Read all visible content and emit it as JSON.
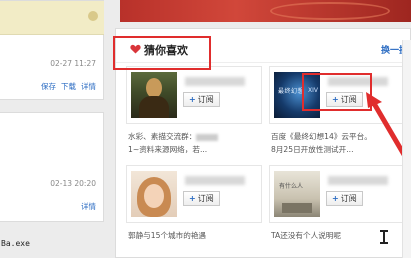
{
  "left": {
    "card1": {
      "time": "02-27 11:27",
      "actions": [
        "保存",
        "下载",
        "详情"
      ]
    },
    "card2": {
      "time": "02-13 20:20",
      "action": "详情"
    },
    "code_text": "Ba.exe"
  },
  "panel": {
    "title": "猜你喜欢",
    "refresh_label": "换一换",
    "items": [
      {
        "button_label": "订阅",
        "desc_line1": "水彩、素描交流群：",
        "desc_line2": "1~资料来源网络，若..."
      },
      {
        "button_label": "订阅",
        "thumb_text_1": "最终幻想",
        "thumb_text_2": "XIV",
        "desc_line1": "百度《最终幻想14》云平台。",
        "desc_line2": "8月25日开放性测试开..."
      },
      {
        "button_label": "订阅",
        "desc_line1": "郭静与15个城市的艳遇",
        "desc_line2": ""
      },
      {
        "button_label": "订阅",
        "thumb_text_1": "有什么人",
        "desc_line1": "TA还没有个人说明呢",
        "desc_line2": ""
      }
    ]
  },
  "colors": {
    "accent_red": "#e02d2d",
    "link_blue": "#2a6bc2"
  }
}
